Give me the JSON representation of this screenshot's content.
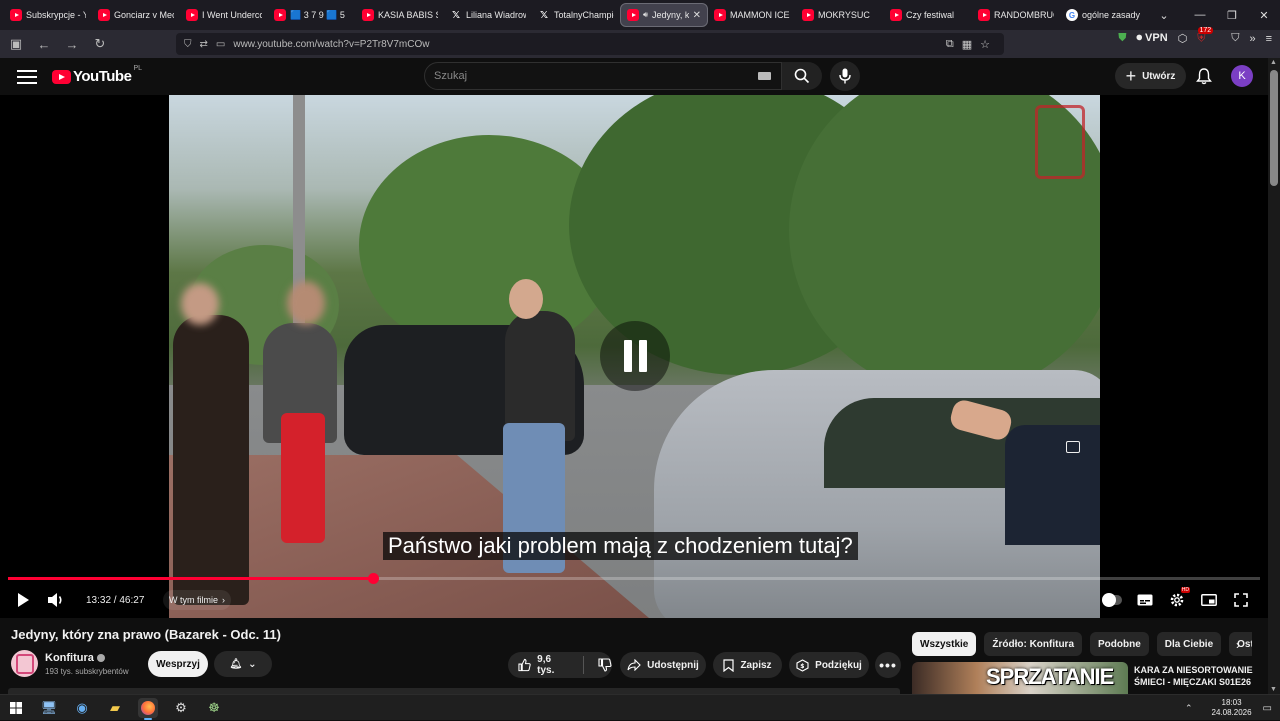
{
  "browser": {
    "tabs": [
      {
        "title": "Subskrypcje - Yo",
        "icon": "youtube-favicon"
      },
      {
        "title": "Gonciarz v Meci",
        "icon": "youtube-favicon"
      },
      {
        "title": "I Went Undercov",
        "icon": "youtube-favicon"
      },
      {
        "title": "🟦 3 7 9 🟦 5",
        "icon": "youtube-favicon"
      },
      {
        "title": "KASIA BABIS SZ",
        "icon": "youtube-favicon"
      },
      {
        "title": "Liliana Wiadrow",
        "icon": "x-favicon"
      },
      {
        "title": "TotalnyChampio",
        "icon": "x-favicon"
      },
      {
        "title": "Jedyny, k",
        "icon": "youtube-favicon",
        "active": true
      },
      {
        "title": "MAMMON ICEB",
        "icon": "youtube-favicon"
      },
      {
        "title": "MOKRYSUC",
        "icon": "youtube-favicon"
      },
      {
        "title": "Czy festiwal",
        "icon": "youtube-favicon"
      },
      {
        "title": "RANDOMBRUCE",
        "icon": "youtube-favicon"
      },
      {
        "title": "ogólne zasady w",
        "icon": "google-favicon"
      }
    ],
    "url": "www.youtube.com/watch?v=P2Tr8V7mCOw",
    "vpn_label": "VPN",
    "ext_badge": "172"
  },
  "youtube": {
    "logo_text": "YouTube",
    "country_code": "PL",
    "search_placeholder": "Szukaj",
    "create_label": "Utwórz",
    "avatar_letter": "K"
  },
  "player": {
    "caption": "Państwo jaki problem mają z chodzeniem tutaj?",
    "current_time": "13:32",
    "duration": "46:27",
    "time_display": "13:32 / 46:27",
    "progress_fraction": 0.2914,
    "chapters_label": "W tym filmie",
    "state": "paused-overlay"
  },
  "video": {
    "title": "Jedyny, który zna prawo (Bazarek - Odc. 11)",
    "channel_name": "Konfitura",
    "subscribers": "193 tys. subskrybentów",
    "support_label": "Wesprzyj",
    "likes": "9,6 tys.",
    "share_label": "Udostępnij",
    "save_label": "Zapisz",
    "thanks_label": "Podziękuj"
  },
  "recommendations": {
    "chips": [
      "Wszystkie",
      "Źródło: Konfitura",
      "Podobne",
      "Dla Ciebie",
      "Ostatnio przesłane"
    ],
    "first": {
      "thumb_text": "SPRZATANIE",
      "title": "KARA ZA NIESORTOWANIE ŚMIECI - MIĘCZAKI S01E26"
    }
  },
  "taskbar": {
    "time": "18:03",
    "date": "24.08.2026"
  },
  "colors": {
    "yt_red": "#ff0033",
    "background": "#0f0f0f",
    "avatar": "#7b3fc4"
  }
}
